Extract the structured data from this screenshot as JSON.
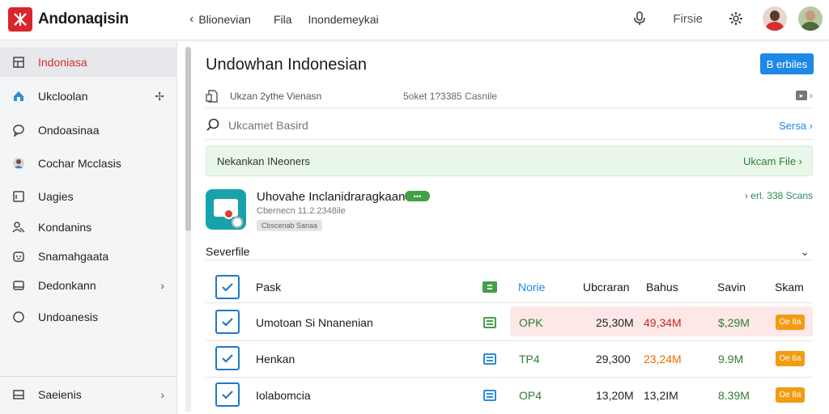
{
  "app": {
    "name": "Andonaqisin",
    "brand_color": "#d9262c"
  },
  "breadcrumb": [
    "Blionevian",
    "Fila",
    "Inondemeykai"
  ],
  "topbar": {
    "label": "Firsie",
    "icons": [
      "microphone-icon",
      "gear-icon"
    ]
  },
  "sidebar": {
    "items": [
      {
        "label": "Indoniasa",
        "icon": "layout-icon",
        "active": true,
        "trail": ""
      },
      {
        "label": "Ukcloolan",
        "icon": "home-icon",
        "active": false,
        "trail": "pin"
      },
      {
        "label": "Ondoasinaa",
        "icon": "chat-icon",
        "active": false,
        "trail": ""
      },
      {
        "label": "Cochar Mcclasis",
        "icon": "avatar-icon",
        "active": false,
        "trail": ""
      },
      {
        "label": "Uagies",
        "icon": "document-icon",
        "active": false,
        "trail": ""
      },
      {
        "label": "Kondanins",
        "icon": "users-icon",
        "active": false,
        "trail": ""
      },
      {
        "label": "Snamahgaata",
        "icon": "bot-icon",
        "active": false,
        "trail": ""
      },
      {
        "label": "Dedonkann",
        "icon": "drive-icon",
        "active": false,
        "trail": "›"
      },
      {
        "label": "Undoanesis",
        "icon": "circle-icon",
        "active": false,
        "trail": ""
      }
    ],
    "footer": {
      "label": "Saeienis",
      "icon": "tray-icon",
      "trail": "›"
    }
  },
  "main": {
    "title": "Undowhan Indonesian",
    "primary_button": "B erbiles",
    "info": {
      "left": "Ukzan 2ythe Vienasn",
      "mid": "5oket 1?3385 Casnile"
    },
    "search": {
      "placeholder": "Ukcamet Basird",
      "link": "Sersa ›"
    },
    "banner": {
      "text": "Nekankan INeoners",
      "link": "Ukcam File ›"
    },
    "card": {
      "title": "Uhovahe Inclanidraragkaan",
      "badge": "•••",
      "subtitle": "Cbernecn 11.2.2348ile",
      "tag": "Cbscenab Sanaa",
      "right": "› erl. 338 Scans"
    },
    "section": {
      "title": "Severfile"
    },
    "table": {
      "headers": [
        "Pask",
        "Norie",
        "Ubcraran",
        "Bahus",
        "Savin",
        "Skam"
      ],
      "rows": [
        {
          "name": "Umotoan Si Nnanenian",
          "status": "OPK",
          "c1": "25,30M",
          "c2": "49,34M",
          "c3": "$,29M",
          "tag": "Oe 8a",
          "highlight": true,
          "icon_color": "green"
        },
        {
          "name": "Henkan",
          "status": "TP4",
          "c1": "29,300",
          "c2": "23,24M",
          "c3": "9.9M",
          "tag": "Oe 6a",
          "highlight": false,
          "icon_color": "blue"
        },
        {
          "name": "Iolabomcia",
          "status": "OP4",
          "c1": "13,20M",
          "c2": "13,2IM",
          "c3": "8.39M",
          "tag": "Oe 8a",
          "highlight": false,
          "icon_color": "blue"
        }
      ]
    }
  }
}
